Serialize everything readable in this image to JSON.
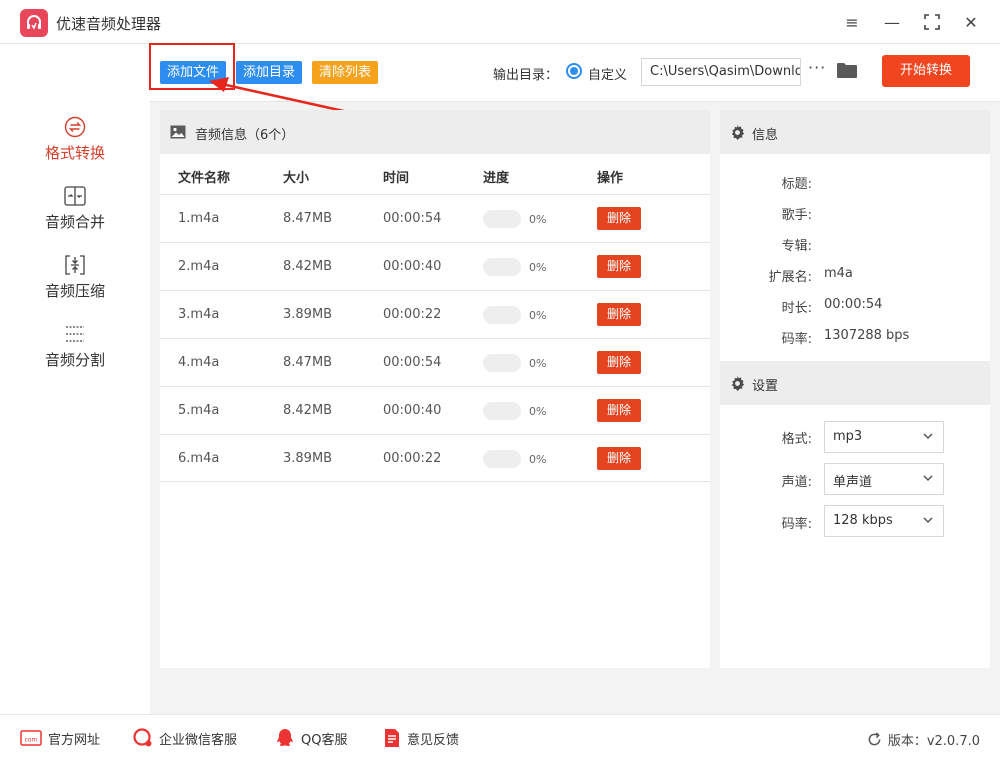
{
  "app": {
    "title": "优速音频处理器"
  },
  "window_controls": {
    "menu": "≡",
    "minimize": "—",
    "maximize": "⛶",
    "close": "✕"
  },
  "sidebar": {
    "items": [
      {
        "label": "格式转换",
        "icon": "convert-icon",
        "active": true
      },
      {
        "label": "音频合并",
        "icon": "merge-icon",
        "active": false
      },
      {
        "label": "音频压缩",
        "icon": "compress-icon",
        "active": false
      },
      {
        "label": "音频分割",
        "icon": "split-icon",
        "active": false
      }
    ]
  },
  "toolbar": {
    "add_file": "添加文件",
    "add_dir": "添加目录",
    "clear_list": "清除列表",
    "output_label": "输出目录：",
    "custom_label": "自定义",
    "path_value": "C:\\Users\\Qasim\\Downlo",
    "more": "···",
    "start": "开始转换"
  },
  "file_panel": {
    "title": "音频信息（6个）",
    "columns": [
      "文件名称",
      "大小",
      "时间",
      "进度",
      "操作"
    ],
    "rows": [
      {
        "name": "1.m4a",
        "size": "8.47MB",
        "time": "00:00:54",
        "progress": "0%",
        "progress_value": 0,
        "action": "删除"
      },
      {
        "name": "2.m4a",
        "size": "8.42MB",
        "time": "00:00:40",
        "progress": "0%",
        "progress_value": 0,
        "action": "删除"
      },
      {
        "name": "3.m4a",
        "size": "3.89MB",
        "time": "00:00:22",
        "progress": "0%",
        "progress_value": 0,
        "action": "删除"
      },
      {
        "name": "4.m4a",
        "size": "8.47MB",
        "time": "00:00:54",
        "progress": "0%",
        "progress_value": 0,
        "action": "删除"
      },
      {
        "name": "5.m4a",
        "size": "8.42MB",
        "time": "00:00:40",
        "progress": "0%",
        "progress_value": 0,
        "action": "删除"
      },
      {
        "name": "6.m4a",
        "size": "3.89MB",
        "time": "00:00:22",
        "progress": "0%",
        "progress_value": 0,
        "action": "删除"
      }
    ]
  },
  "info": {
    "title": "信息",
    "fields": [
      {
        "label": "标题:",
        "value": ""
      },
      {
        "label": "歌手:",
        "value": ""
      },
      {
        "label": "专辑:",
        "value": ""
      },
      {
        "label": "扩展名:",
        "value": "m4a"
      },
      {
        "label": "时长:",
        "value": "00:00:54"
      },
      {
        "label": "码率:",
        "value": "1307288 bps"
      }
    ]
  },
  "settings": {
    "title": "设置",
    "format_label": "格式:",
    "format_value": "mp3",
    "channel_label": "声道:",
    "channel_value": "单声道",
    "bitrate_label": "码率:",
    "bitrate_value": "128 kbps"
  },
  "footer": {
    "website": "官方网址",
    "wecom": "企业微信客服",
    "qq": "QQ客服",
    "feedback": "意见反馈",
    "version": "版本：v2.0.7.0"
  },
  "colors": {
    "accent_blue": "#2e8df0",
    "accent_orange": "#f7a21b",
    "start_red": "#f0451f",
    "delete_red": "#e34521",
    "active_nav": "#d4402a",
    "annotation_red": "#e8261e"
  }
}
